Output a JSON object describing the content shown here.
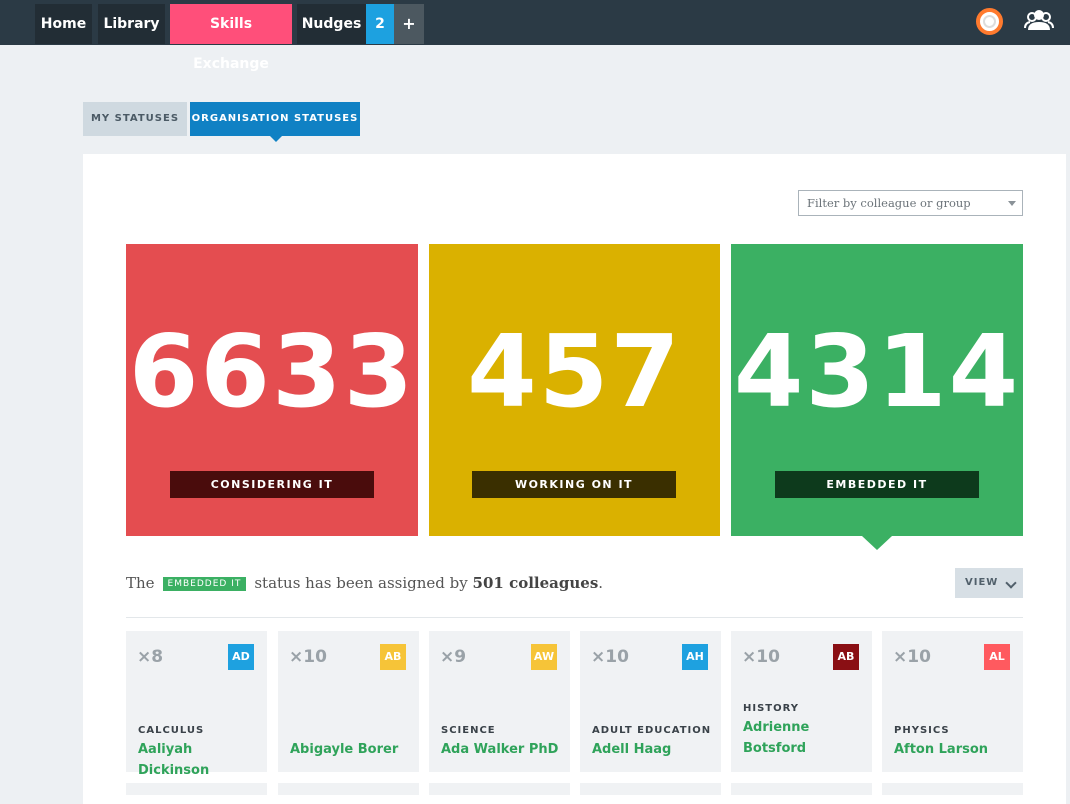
{
  "nav": {
    "items": [
      "Home",
      "Library",
      "Skills Exchange",
      "Nudges"
    ],
    "badge_count": "2",
    "plus": "+",
    "accent": "#ff4f7a",
    "icons": [
      "lifebuoy-icon",
      "colleagues-icon"
    ]
  },
  "tabs": {
    "my_statuses": "MY STATUSES",
    "organisation_statuses": "ORGANISATION STATUSES"
  },
  "filter": {
    "placeholder": "Filter by colleague or group"
  },
  "stats": [
    {
      "value": "6633",
      "label": "CONSIDERING IT",
      "color": "#e44d50"
    },
    {
      "value": "457",
      "label": "WORKING ON IT",
      "color": "#dab100"
    },
    {
      "value": "4314",
      "label": "EMBEDDED IT",
      "color": "#3bb063"
    }
  ],
  "summary": {
    "prefix": "The",
    "pill": "EMBEDDED IT",
    "middle": "status has been assigned by",
    "count": "501 colleagues",
    "suffix": "."
  },
  "view_button": "VIEW",
  "cards": [
    {
      "mult": "×8",
      "initials": "AD",
      "badge_color": "#1ea1e0",
      "subject": "CALCULUS",
      "name": "Aaliyah Dickinson"
    },
    {
      "mult": "×10",
      "initials": "AB",
      "badge_color": "#f6c438",
      "subject": "",
      "name": "Abigayle Borer"
    },
    {
      "mult": "×9",
      "initials": "AW",
      "badge_color": "#f6c438",
      "subject": "SCIENCE",
      "name": "Ada Walker PhD"
    },
    {
      "mult": "×10",
      "initials": "AH",
      "badge_color": "#1ea1e0",
      "subject": "ADULT EDUCATION",
      "name": "Adell Haag"
    },
    {
      "mult": "×10",
      "initials": "AB",
      "badge_color": "#8a0f14",
      "subject": "HISTORY",
      "name": "Adrienne Botsford"
    },
    {
      "mult": "×10",
      "initials": "AL",
      "badge_color": "#ff5a5f",
      "subject": "PHYSICS",
      "name": "Afton Larson"
    }
  ]
}
